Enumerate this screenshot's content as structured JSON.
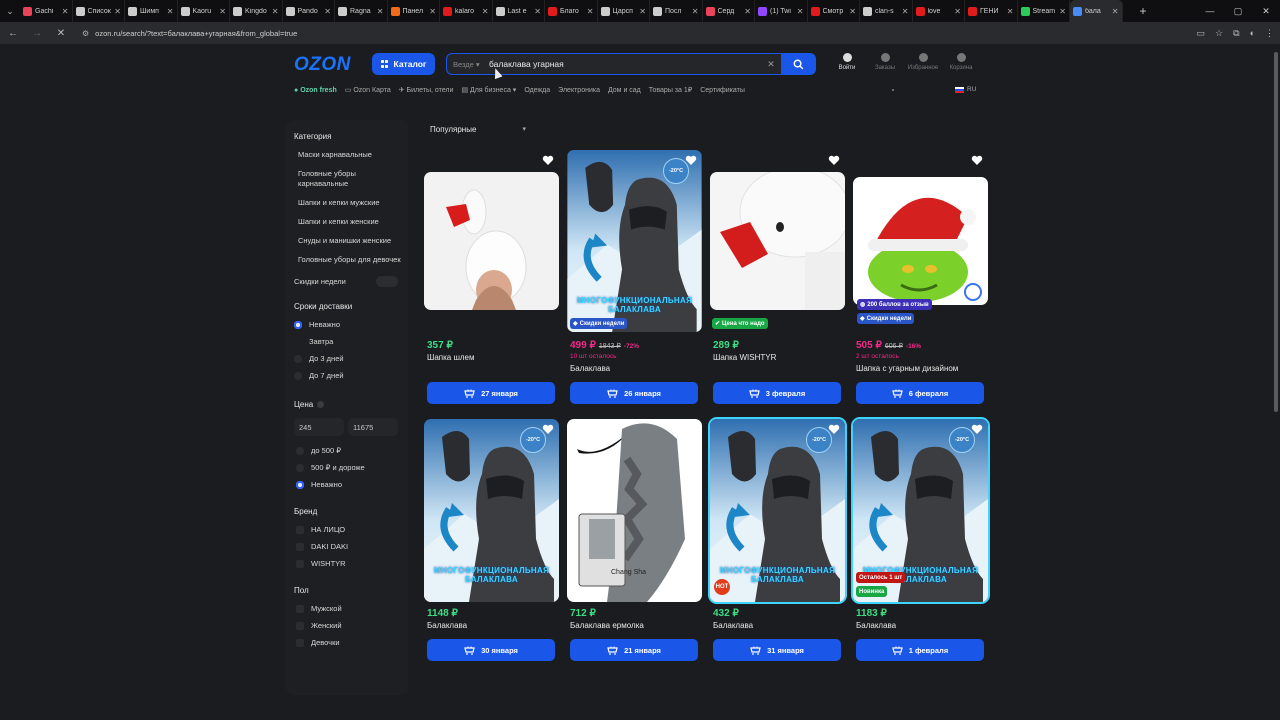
{
  "browser": {
    "tabs": [
      {
        "label": "Gachi",
        "color": "#e9435a"
      },
      {
        "label": "Список",
        "color": "#cccccc"
      },
      {
        "label": "Шимп",
        "color": "#cccccc"
      },
      {
        "label": "Kaoru",
        "color": "#cccccc"
      },
      {
        "label": "Kingdo",
        "color": "#cccccc"
      },
      {
        "label": "Pando",
        "color": "#cccccc"
      },
      {
        "label": "Ragna",
        "color": "#cccccc"
      },
      {
        "label": "Панел",
        "color": "#f06a1a"
      },
      {
        "label": "kalaro",
        "color": "#e01b1b"
      },
      {
        "label": "Last e",
        "color": "#cccccc"
      },
      {
        "label": "Благо",
        "color": "#e01b1b"
      },
      {
        "label": "Царсп",
        "color": "#cccccc"
      },
      {
        "label": "Посл",
        "color": "#cccccc"
      },
      {
        "label": "Серд",
        "color": "#e9435a"
      },
      {
        "label": "(1) Twi",
        "color": "#9146ff"
      },
      {
        "label": "Смотр",
        "color": "#e01b1b"
      },
      {
        "label": "clan-s",
        "color": "#cccccc"
      },
      {
        "label": "love",
        "color": "#e01b1b"
      },
      {
        "label": "ГЕНИ",
        "color": "#e01b1b"
      },
      {
        "label": "Stream",
        "color": "#2ec95a"
      },
      {
        "label": "бала",
        "color": "#4a8af4",
        "active": true
      }
    ],
    "url": "ozon.ru/search/?text=балаклава+угарная&from_global=true"
  },
  "header": {
    "logo": "OZON",
    "catalog_label": "Каталог",
    "search_scope": "Везде",
    "search_value": "балаклава угарная",
    "user_icons": [
      "Войти",
      "Заказы",
      "Избранное",
      "Корзина"
    ],
    "subnav": [
      "Ozon fresh",
      "Ozon Карта",
      "Билеты, отели",
      "Для бизнеса",
      "Одежда",
      "Электроника",
      "Дом и сад",
      "Товары за 1₽",
      "Сертификаты"
    ],
    "lang": "RU"
  },
  "sidebar": {
    "category_title": "Категория",
    "categories": [
      "Маски карнавальные",
      "Головные уборы карнавальные",
      "Шапки и кепки мужские",
      "Шапки и кепки женские",
      "Снуды и манишки женские",
      "Головные уборы для девочек"
    ],
    "discounts_label": "Скидки недели",
    "delivery_title": "Сроки доставки",
    "delivery_options": [
      "Неважно",
      "Завтра",
      "До 3 дней",
      "До 7 дней"
    ],
    "price_title": "Цена",
    "price_from": "245",
    "price_to": "11675",
    "price_options": [
      "до 500 ₽",
      "500 ₽ и дороже",
      "Неважно"
    ],
    "brand_title": "Бренд",
    "brands": [
      "НА ЛИЦО",
      "DAKI DAKI",
      "WISHTYR"
    ],
    "gender_title": "Пол",
    "genders": [
      "Мужской",
      "Женский",
      "Девочки"
    ]
  },
  "sort_label": "Популярные",
  "products": [
    {
      "price": "357 ₽",
      "title": "Шапка шлем",
      "delivery": "27 января",
      "price_color": "#3ddc84"
    },
    {
      "price": "499 ₽",
      "old": "1843 ₽",
      "disc": "-72%",
      "stock": "10 шт осталось",
      "title": "Балаклава",
      "delivery": "26 января",
      "price_color": "#f4288a",
      "badge": "Скидки недели",
      "temp": "-20°C",
      "ptext": "МНОГОФУНКЦИОНАЛЬНАЯ БАЛАКЛАВА"
    },
    {
      "price": "289 ₽",
      "title": "Шапка WISHTYR",
      "delivery": "3 февраля",
      "price_color": "#3ddc84",
      "badge": "Цена что надо"
    },
    {
      "price": "505 ₽",
      "old": "606 ₽",
      "disc": "-16%",
      "stock": "2 шт осталось",
      "title": "Шапка с угарным дизайном",
      "delivery": "6 февраля",
      "price_color": "#f4288a",
      "badge": "Скидки недели",
      "badge2": "200 баллов за отзыв"
    },
    {
      "price": "1148 ₽",
      "title": "Балаклава",
      "delivery": "30 января",
      "price_color": "#3ddc84",
      "temp": "-20°C",
      "ptext": "МНОГОФУНКЦИОНАЛЬНАЯ БАЛАКЛАВА"
    },
    {
      "price": "712 ₽",
      "title": "Балаклава ермолка",
      "delivery": "21 января",
      "price_color": "#3ddc84",
      "brandtext": "Chang Sha"
    },
    {
      "price": "432 ₽",
      "title": "Балаклава",
      "delivery": "31 января",
      "price_color": "#3ddc84",
      "temp": "-20°C",
      "ptext": "МНОГОФУНКЦИОНАЛЬНАЯ БАЛАКЛАВА",
      "hot": "HOT"
    },
    {
      "price": "1183 ₽",
      "title": "Балаклава",
      "delivery": "1 февраля",
      "price_color": "#3ddc84",
      "temp": "-20°C",
      "ptext": "МНОГОФУНКЦИОНАЛЬНАЯ БАЛАКЛАВА",
      "badge": "Осталось 1 шт",
      "badge_new": "Новинка"
    }
  ]
}
